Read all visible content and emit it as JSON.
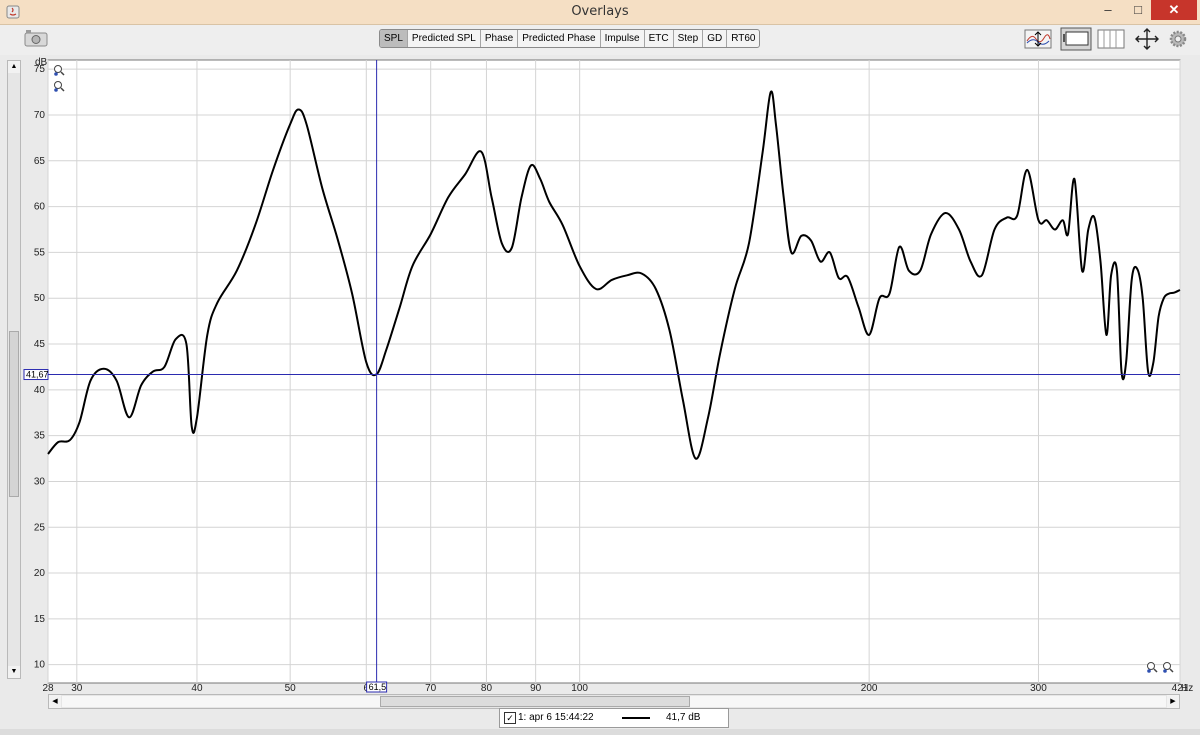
{
  "window": {
    "title": "Overlays",
    "min_glyph": "–",
    "max_glyph": "□",
    "close_glyph": "✕"
  },
  "toolbar": {
    "tabs": [
      "SPL",
      "Predicted SPL",
      "Phase",
      "Predicted Phase",
      "Impulse",
      "ETC",
      "Step",
      "GD",
      "RT60"
    ],
    "active_tab": "SPL",
    "tool_icons": [
      "curve-controls-icon",
      "graph-window-icon",
      "layout-icon",
      "fit-arrows-icon",
      "settings-gear-icon"
    ]
  },
  "scrollbars": {
    "up_glyph": "▲",
    "down_glyph": "▼",
    "left_glyph": "◀",
    "right_glyph": "▶"
  },
  "legend": {
    "checked": true,
    "checkbox_glyph": "✓",
    "name": "1: apr 6 15:44:22",
    "value": "41,7 dB"
  },
  "chart_data": {
    "type": "line",
    "title": "",
    "ylabel": "dB",
    "xunit": "Hz",
    "xscale": "log",
    "xlim": [
      28,
      421
    ],
    "ylim": [
      8,
      76
    ],
    "grid": true,
    "y_ticks": [
      10,
      15,
      20,
      25,
      30,
      35,
      40,
      45,
      50,
      55,
      60,
      65,
      70,
      75
    ],
    "x_ticks": [
      {
        "value": 28,
        "label": "28"
      },
      {
        "value": 30,
        "label": "30"
      },
      {
        "value": 40,
        "label": "40"
      },
      {
        "value": 50,
        "label": "50"
      },
      {
        "value": 60,
        "label": "6"
      },
      {
        "value": 70,
        "label": "70"
      },
      {
        "value": 80,
        "label": "80"
      },
      {
        "value": 90,
        "label": "90"
      },
      {
        "value": 100,
        "label": "100"
      },
      {
        "value": 200,
        "label": "200"
      },
      {
        "value": 300,
        "label": "300"
      },
      {
        "value": 421,
        "label": "421"
      }
    ],
    "cursor": {
      "x": 61.5,
      "y": 41.67,
      "x_label": "61,5",
      "y_label": "41,67"
    },
    "line_color": "#000000",
    "cursor_color": "#2b2bb0",
    "series": [
      {
        "x": [
          28,
          28.7,
          29.5,
          30.2,
          31,
          32,
          33,
          34,
          35,
          36,
          37,
          38,
          39,
          39.5,
          40,
          41,
          42,
          44,
          46,
          48,
          50,
          51,
          52,
          54,
          56,
          58,
          60,
          61.5,
          63,
          65,
          67,
          70,
          73,
          76,
          79,
          81,
          83,
          85,
          87,
          89,
          91,
          93,
          96,
          100,
          104,
          108,
          112,
          116,
          120,
          124,
          128,
          132,
          136,
          140,
          145,
          150,
          155,
          158,
          160,
          163,
          166,
          170,
          174,
          178,
          182,
          186,
          190,
          195,
          200,
          205,
          210,
          215,
          220,
          226,
          232,
          240,
          248,
          255,
          262,
          270,
          278,
          285,
          292,
          300,
          306,
          312,
          318,
          322,
          327,
          333,
          338,
          343,
          348,
          353,
          357,
          362,
          366,
          370,
          375,
          380,
          385,
          390,
          395,
          400,
          405,
          410,
          415,
          421
        ],
        "y": [
          33,
          34.3,
          34.5,
          36.5,
          41,
          42.3,
          41,
          37,
          40.5,
          42,
          42.5,
          45.5,
          45,
          36,
          37,
          46,
          49.5,
          53,
          58,
          64,
          69,
          70.6,
          69,
          62,
          56.5,
          50.5,
          43,
          41.7,
          44.5,
          49,
          53.5,
          57,
          61,
          63.5,
          66,
          61,
          56,
          55.5,
          61,
          64.5,
          63,
          60.5,
          58,
          53.5,
          51,
          52,
          52.5,
          52.7,
          51,
          46.5,
          39,
          32.5,
          37,
          44,
          51,
          56,
          66,
          72.5,
          69,
          61,
          55,
          56.8,
          56.3,
          54,
          55,
          52.2,
          52.3,
          49,
          46,
          50,
          50.5,
          55.6,
          53,
          53,
          57,
          59.3,
          57.5,
          54,
          52.5,
          57.5,
          58.8,
          59,
          64,
          58.5,
          58.5,
          57.5,
          58.5,
          57,
          63,
          53,
          57.5,
          58.8,
          54,
          46,
          52.5,
          53,
          42,
          43,
          52,
          53.2,
          50,
          42,
          43,
          48,
          50,
          50.5,
          50.6,
          50.9
        ]
      }
    ]
  }
}
